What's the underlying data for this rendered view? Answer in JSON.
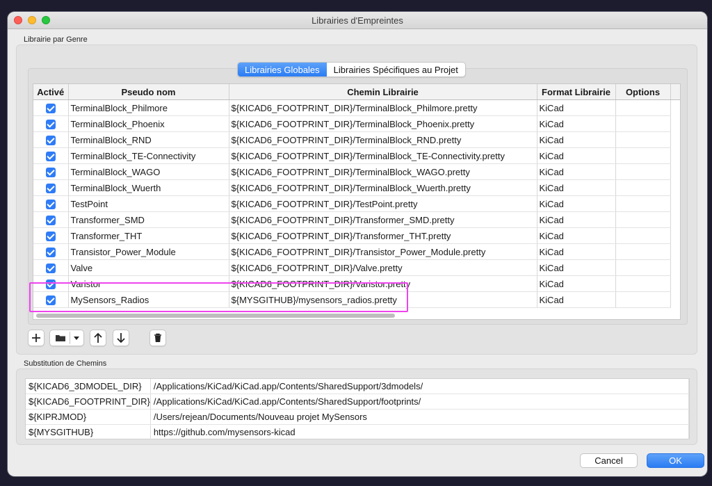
{
  "window": {
    "title": "Librairies d'Empreintes"
  },
  "section1_label": "Librairie par Genre",
  "tabs": [
    {
      "label": "Librairies Globales",
      "active": true
    },
    {
      "label": "Librairies Spécifiques au Projet",
      "active": false
    }
  ],
  "lib_table": {
    "headers": [
      "Activé",
      "Pseudo nom",
      "Chemin Librairie",
      "Format Librairie",
      "Options"
    ],
    "rows": [
      {
        "active": true,
        "name": "TerminalBlock_Philmore",
        "path": "${KICAD6_FOOTPRINT_DIR}/TerminalBlock_Philmore.pretty",
        "format": "KiCad",
        "options": ""
      },
      {
        "active": true,
        "name": "TerminalBlock_Phoenix",
        "path": "${KICAD6_FOOTPRINT_DIR}/TerminalBlock_Phoenix.pretty",
        "format": "KiCad",
        "options": ""
      },
      {
        "active": true,
        "name": "TerminalBlock_RND",
        "path": "${KICAD6_FOOTPRINT_DIR}/TerminalBlock_RND.pretty",
        "format": "KiCad",
        "options": ""
      },
      {
        "active": true,
        "name": "TerminalBlock_TE-Connectivity",
        "path": "${KICAD6_FOOTPRINT_DIR}/TerminalBlock_TE-Connectivity.pretty",
        "format": "KiCad",
        "options": ""
      },
      {
        "active": true,
        "name": "TerminalBlock_WAGO",
        "path": "${KICAD6_FOOTPRINT_DIR}/TerminalBlock_WAGO.pretty",
        "format": "KiCad",
        "options": ""
      },
      {
        "active": true,
        "name": "TerminalBlock_Wuerth",
        "path": "${KICAD6_FOOTPRINT_DIR}/TerminalBlock_Wuerth.pretty",
        "format": "KiCad",
        "options": ""
      },
      {
        "active": true,
        "name": "TestPoint",
        "path": "${KICAD6_FOOTPRINT_DIR}/TestPoint.pretty",
        "format": "KiCad",
        "options": ""
      },
      {
        "active": true,
        "name": "Transformer_SMD",
        "path": "${KICAD6_FOOTPRINT_DIR}/Transformer_SMD.pretty",
        "format": "KiCad",
        "options": ""
      },
      {
        "active": true,
        "name": "Transformer_THT",
        "path": "${KICAD6_FOOTPRINT_DIR}/Transformer_THT.pretty",
        "format": "KiCad",
        "options": ""
      },
      {
        "active": true,
        "name": "Transistor_Power_Module",
        "path": "${KICAD6_FOOTPRINT_DIR}/Transistor_Power_Module.pretty",
        "format": "KiCad",
        "options": ""
      },
      {
        "active": true,
        "name": "Valve",
        "path": "${KICAD6_FOOTPRINT_DIR}/Valve.pretty",
        "format": "KiCad",
        "options": ""
      },
      {
        "active": true,
        "name": "Varistor",
        "path": "${KICAD6_FOOTPRINT_DIR}/Varistor.pretty",
        "format": "KiCad",
        "options": ""
      },
      {
        "active": true,
        "name": "MySensors_Radios",
        "path": "${MYSGITHUB}/mysensors_radios.pretty",
        "format": "KiCad",
        "options": ""
      }
    ]
  },
  "toolbar": {
    "add_icon": "plus-icon",
    "folder_icon": "folder-icon",
    "dropdown_icon": "chevron-down-icon",
    "up_icon": "arrow-up-icon",
    "down_icon": "arrow-down-icon",
    "delete_icon": "trash-icon"
  },
  "section2_label": "Substitution de Chemins",
  "path_subs": [
    {
      "var": "${KICAD6_3DMODEL_DIR}",
      "value": "/Applications/KiCad/KiCad.app/Contents/SharedSupport/3dmodels/"
    },
    {
      "var": "${KICAD6_FOOTPRINT_DIR}",
      "value": "/Applications/KiCad/KiCad.app/Contents/SharedSupport/footprints/"
    },
    {
      "var": "${KIPRJMOD}",
      "value": "/Users/rejean/Documents/Nouveau projet MySensors"
    },
    {
      "var": "${MYSGITHUB}",
      "value": "https://github.com/mysensors-kicad"
    }
  ],
  "buttons": {
    "cancel": "Cancel",
    "ok": "OK"
  },
  "colors": {
    "accent": "#2f7cf6",
    "highlight": "#ee44ee"
  }
}
